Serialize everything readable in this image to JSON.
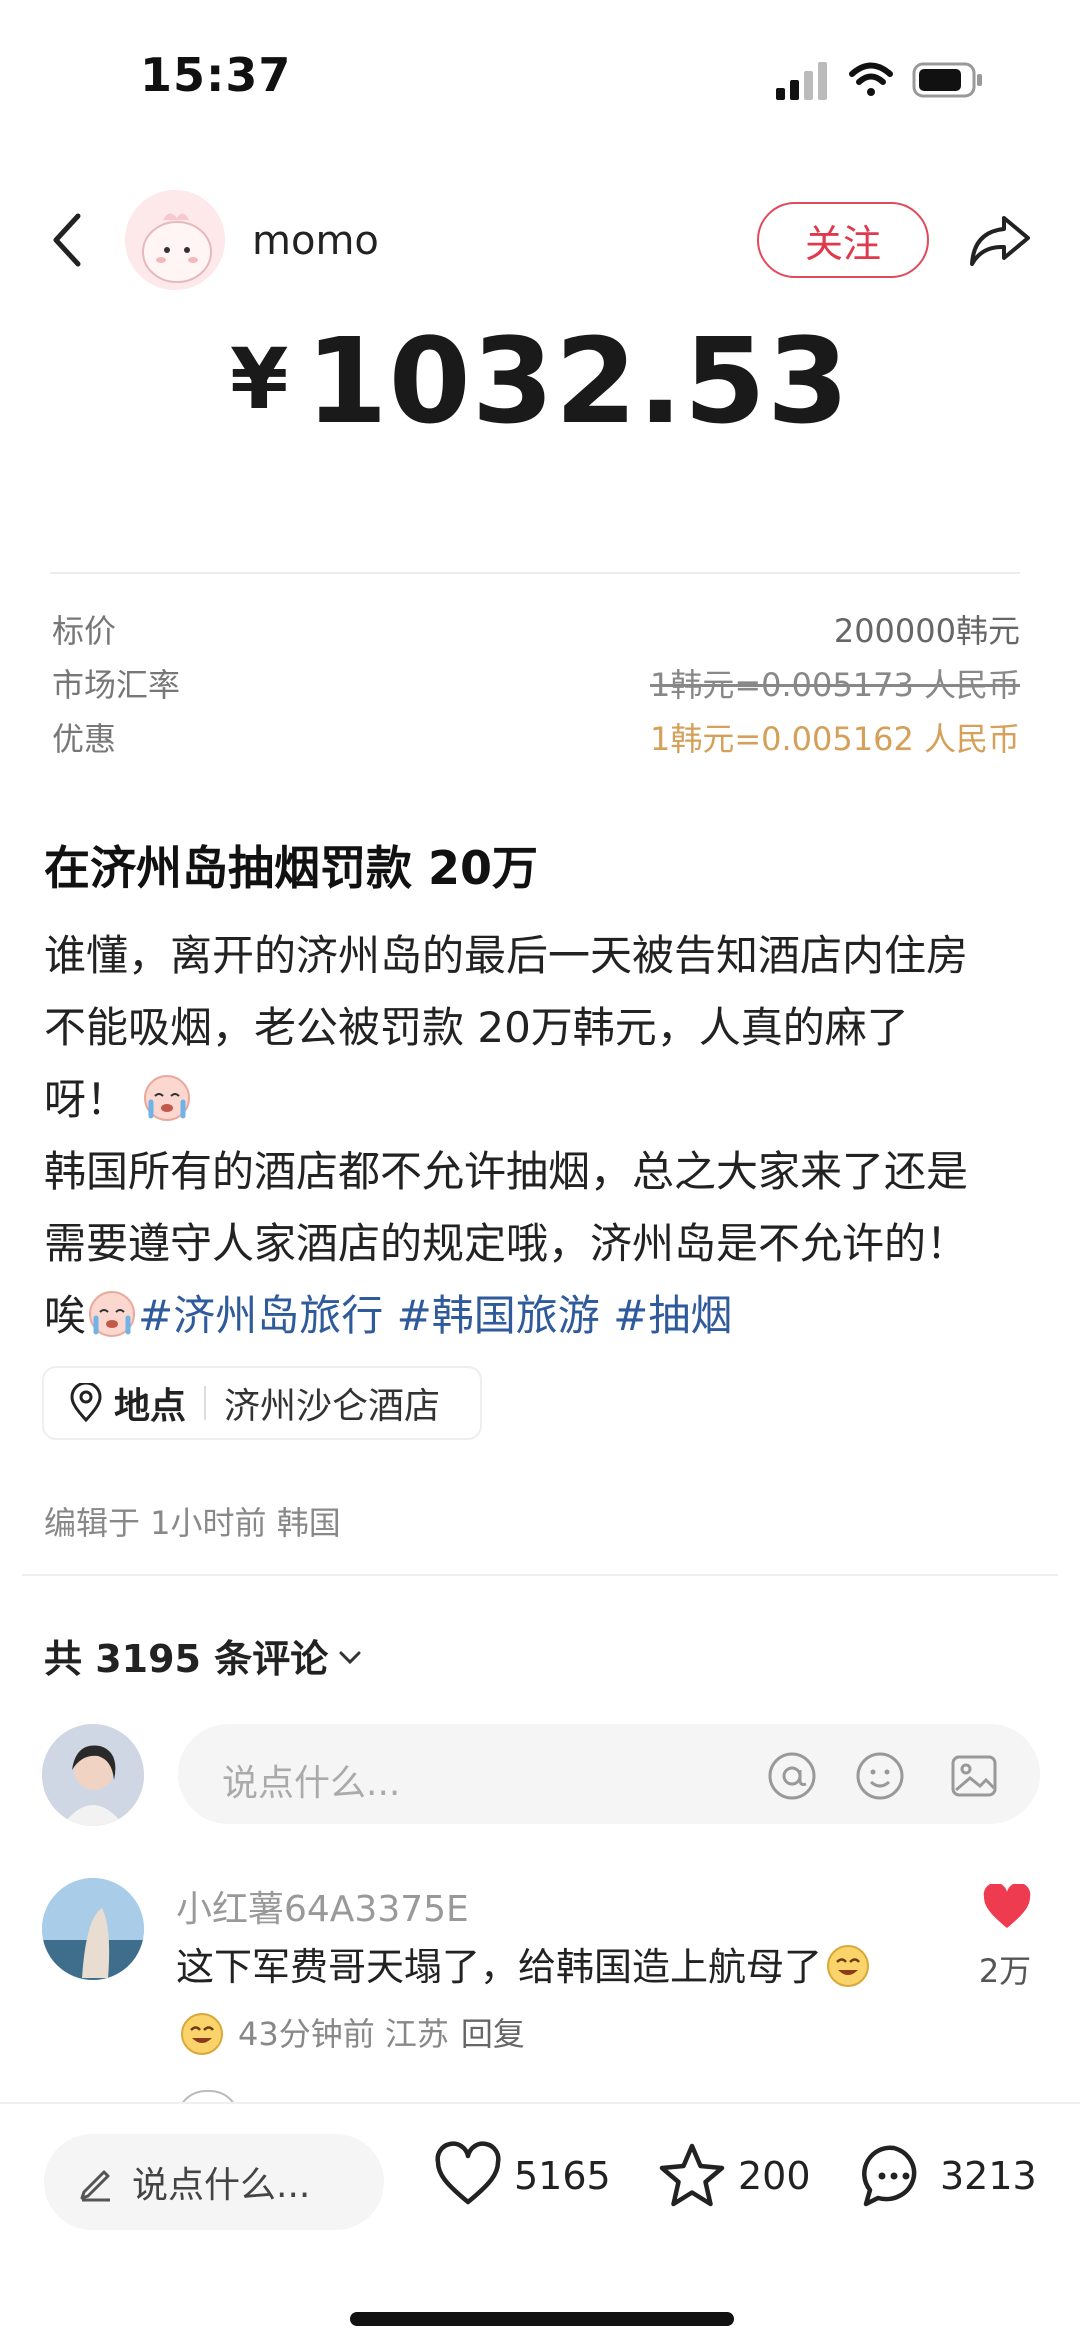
{
  "status_bar": {
    "time": "15:37"
  },
  "header": {
    "author_name": "momo",
    "follow_label": "关注"
  },
  "price": {
    "currency": "¥",
    "amount": "1032.53"
  },
  "info": {
    "rows": [
      {
        "label": "标价",
        "value": "200000韩元"
      },
      {
        "label": "市场汇率",
        "value": "1韩元=0.005173 人民币"
      },
      {
        "label": "优惠",
        "value": "1韩元=0.005162 人民币"
      }
    ]
  },
  "post": {
    "title": "在济州岛抽烟罚款 20万",
    "line1": "谁懂，离开的济州岛的最后一天被告知酒店内住房",
    "line2": "不能吸烟，老公被罚款 20万韩元，人真的麻了",
    "line3": "呀！",
    "line4": "韩国所有的酒店都不允许抽烟，总之大家来了还是",
    "line5": "需要遵守人家酒店的规定哦，济州岛是不允许的！",
    "line6_prefix": "唉",
    "tags": [
      "#济州岛旅行",
      "#韩国旅游",
      "#抽烟"
    ]
  },
  "location": {
    "label": "地点",
    "name": "济州沙仑酒店"
  },
  "edited": "编辑于 1小时前 韩国",
  "comments": {
    "count_label": "共 3195 条评论",
    "input_placeholder": "说点什么...",
    "items": [
      {
        "user": "小红薯64A3375E",
        "text": "这下军费哥天塌了，给韩国造上航母了",
        "meta": "43分钟前 江苏",
        "reply_label": "回复",
        "likes": "2万"
      }
    ]
  },
  "bottom_bar": {
    "input_placeholder": "说点什么...",
    "likes": "5165",
    "stars": "200",
    "comments": "3213"
  },
  "colors": {
    "accent_red": "#e0394c",
    "tag_blue": "#2f5a9b",
    "gold": "#d4a05a"
  }
}
